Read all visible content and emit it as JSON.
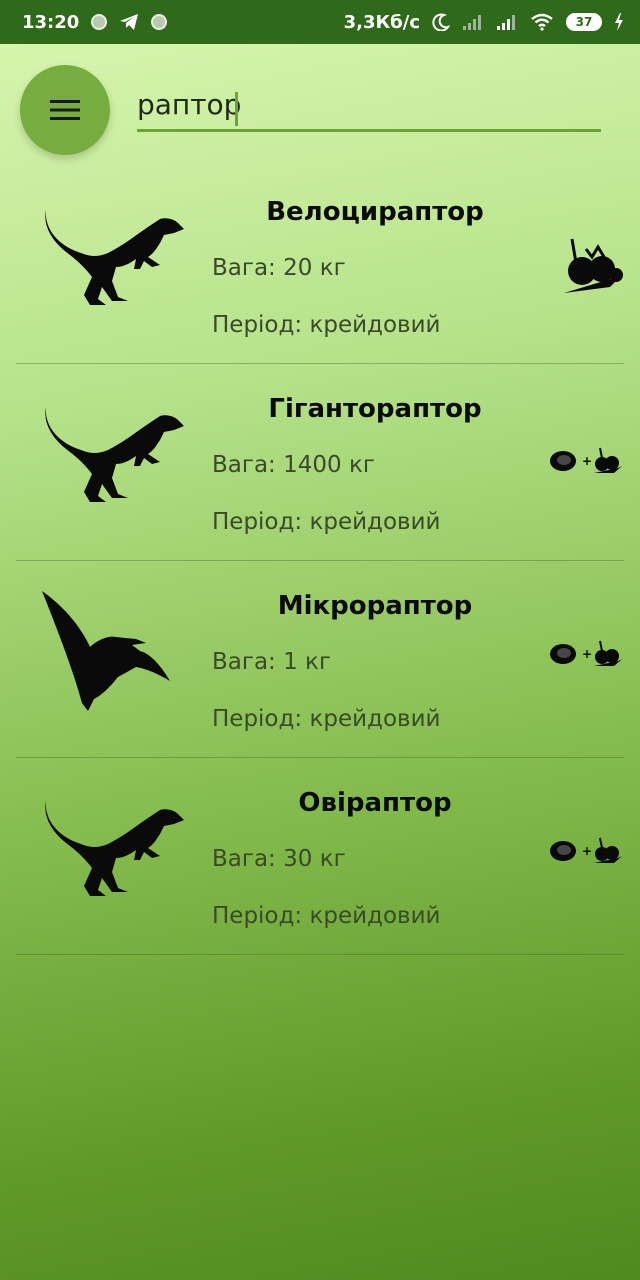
{
  "status_bar": {
    "time": "13:20",
    "network_speed": "3,3Кб/с",
    "battery": "37",
    "icons": [
      "notification-dot-icon",
      "telegram-icon",
      "notification-dot-icon",
      "moon-icon",
      "signal-icon",
      "signal-icon",
      "wifi-icon",
      "battery-icon",
      "charging-icon"
    ]
  },
  "search": {
    "value": "раптор",
    "accent_color": "#6aa52f"
  },
  "menu": {
    "icon": "hamburger-menu-icon"
  },
  "dinosaurs": [
    {
      "name": "Велоцираптор",
      "weight": "Вага: 20 кг",
      "period": "Період: крейдовий",
      "silhouette": "raptor-icon",
      "diet": "herbivore-icon"
    },
    {
      "name": "Гіганторaптор",
      "weight": "Вага: 1400 кг",
      "period": "Період: крейдовий",
      "silhouette": "raptor-icon",
      "diet": "omnivore-icon"
    },
    {
      "name": "Мікрораптор",
      "weight": "Вага: 1 кг",
      "period": "Період: крейдовий",
      "silhouette": "pterosaur-icon",
      "diet": "omnivore-icon"
    },
    {
      "name": "Овіраптор",
      "weight": "Вага: 30 кг",
      "period": "Період: крейдовий",
      "silhouette": "raptor-icon",
      "diet": "omnivore-icon"
    }
  ]
}
